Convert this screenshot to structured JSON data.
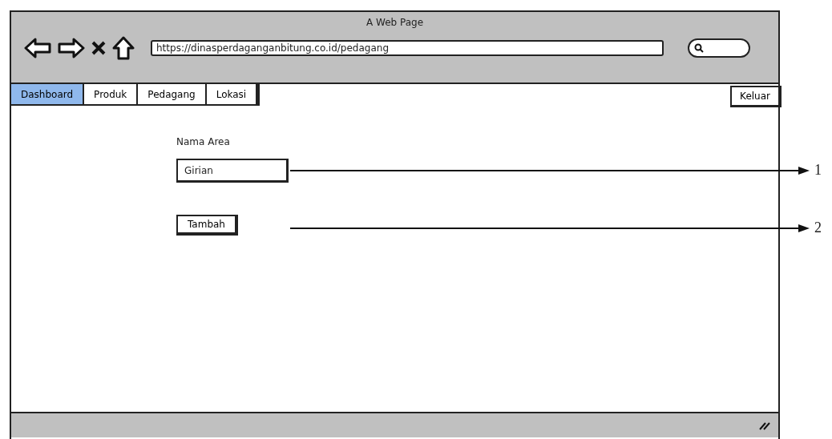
{
  "window": {
    "title": "A Web Page",
    "url": "https://dinasperdaganganbitung.co.id/pedagang"
  },
  "tabs": [
    {
      "label": "Dashboard",
      "selected": true
    },
    {
      "label": "Produk",
      "selected": false
    },
    {
      "label": "Pedagang",
      "selected": false
    },
    {
      "label": "Lokasi",
      "selected": false
    }
  ],
  "logout_button": "Keluar",
  "form": {
    "label": "Nama Area",
    "field_value": "Girian",
    "button": "Tambah"
  },
  "annotations": [
    {
      "label": "1"
    },
    {
      "label": "2"
    }
  ]
}
